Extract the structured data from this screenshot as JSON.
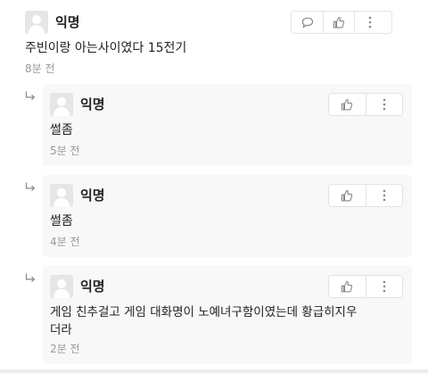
{
  "comments": [
    {
      "author": "익명",
      "text": "주빈이랑 아는사이였다 15전기",
      "time": "8분 전"
    }
  ],
  "replies": [
    {
      "author": "익명",
      "text": "썰좀",
      "time": "5분 전"
    },
    {
      "author": "익명",
      "text": "썰좀",
      "time": "4분 전"
    },
    {
      "author": "익명",
      "text_line1": "게임 친추걸고 게임 대화명이 노예녀구함이였는데  황급히지우",
      "text_line2": "더라",
      "time": "2분 전"
    }
  ],
  "icons": {
    "comment": "speech-bubble-icon",
    "like": "thumbs-up-icon",
    "more": "vertical-dots-icon",
    "reply": "reply-arrow-icon"
  },
  "colors": {
    "reply_bg": "#f8f8f8",
    "meta": "#999999",
    "border": "#e3e3e3"
  }
}
